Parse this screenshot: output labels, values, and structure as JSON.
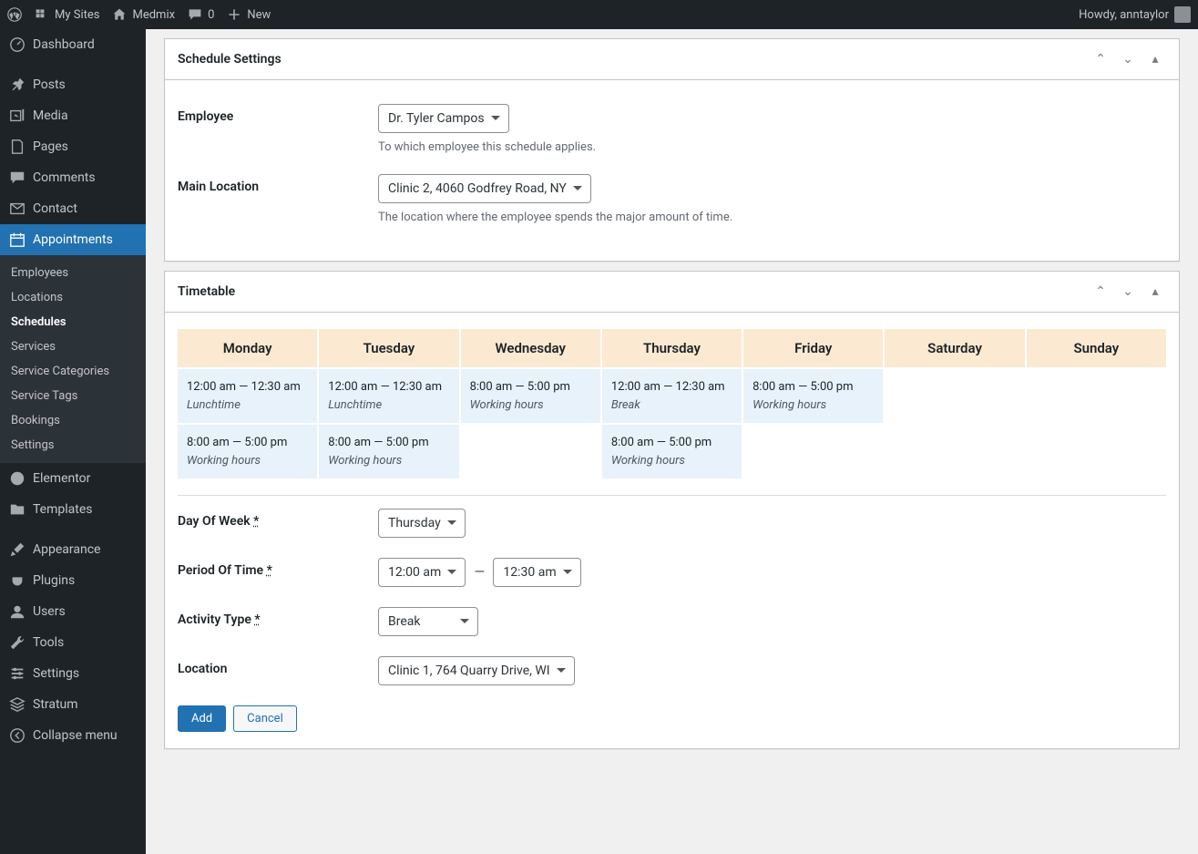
{
  "adminBar": {
    "mySites": "My Sites",
    "siteName": "Medmix",
    "commentCount": "0",
    "new": "New",
    "howdy": "Howdy, anntaylor"
  },
  "sidebar": {
    "dashboard": "Dashboard",
    "posts": "Posts",
    "media": "Media",
    "pages": "Pages",
    "comments": "Comments",
    "contact": "Contact",
    "appointments": "Appointments",
    "elementor": "Elementor",
    "templates": "Templates",
    "appearance": "Appearance",
    "plugins": "Plugins",
    "users": "Users",
    "tools": "Tools",
    "settings": "Settings",
    "stratum": "Stratum",
    "collapse": "Collapse menu",
    "sub": {
      "employees": "Employees",
      "locations": "Locations",
      "schedules": "Schedules",
      "services": "Services",
      "serviceCategories": "Service Categories",
      "serviceTags": "Service Tags",
      "bookings": "Bookings",
      "settings": "Settings"
    }
  },
  "scheduleSettings": {
    "title": "Schedule Settings",
    "employeeLabel": "Employee",
    "employeeValue": "Dr. Tyler Campos",
    "employeeDesc": "To which employee this schedule applies.",
    "mainLocationLabel": "Main Location",
    "mainLocationValue": "Clinic 2, 4060 Godfrey Road, NY",
    "mainLocationDesc": "The location where the employee spends the major amount of time."
  },
  "timetable": {
    "title": "Timetable",
    "days": [
      "Monday",
      "Tuesday",
      "Wednesday",
      "Thursday",
      "Friday",
      "Saturday",
      "Sunday"
    ],
    "columns": [
      [
        {
          "time": "12:00 am — 12:30 am",
          "label": "Lunchtime"
        },
        {
          "time": "8:00 am — 5:00 pm",
          "label": "Working hours"
        }
      ],
      [
        {
          "time": "12:00 am — 12:30 am",
          "label": "Lunchtime"
        },
        {
          "time": "8:00 am — 5:00 pm",
          "label": "Working hours"
        }
      ],
      [
        {
          "time": "8:00 am — 5:00 pm",
          "label": "Working hours"
        }
      ],
      [
        {
          "time": "12:00 am — 12:30 am",
          "label": "Break"
        },
        {
          "time": "8:00 am — 5:00 pm",
          "label": "Working hours"
        }
      ],
      [
        {
          "time": "8:00 am — 5:00 pm",
          "label": "Working hours"
        }
      ],
      [],
      []
    ]
  },
  "form": {
    "dayLabel": "Day Of Week ",
    "dayValue": "Thursday",
    "periodLabel": "Period Of Time ",
    "periodStart": "12:00 am",
    "periodEnd": "12:30 am",
    "activityLabel": "Activity Type ",
    "activityValue": "Break",
    "locationLabel": "Location",
    "locationValue": "Clinic 1, 764 Quarry Drive, WI",
    "addBtn": "Add",
    "cancelBtn": "Cancel",
    "req": "*"
  }
}
